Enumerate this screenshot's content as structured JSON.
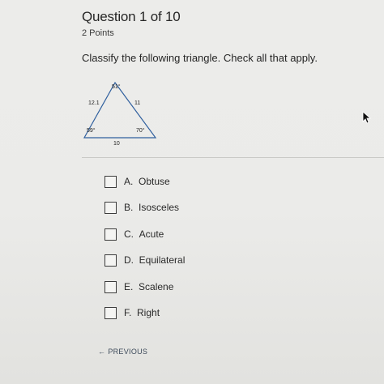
{
  "question": {
    "title": "Question 1 of 10",
    "points": "2 Points",
    "prompt": "Classify the following triangle. Check all that apply."
  },
  "triangle": {
    "angle_top": "51°",
    "angle_left": "59°",
    "angle_right": "70°",
    "side_left": "12.1",
    "side_right": "11",
    "side_bottom": "10"
  },
  "options": [
    {
      "letter": "A.",
      "text": "Obtuse"
    },
    {
      "letter": "B.",
      "text": "Isosceles"
    },
    {
      "letter": "C.",
      "text": "Acute"
    },
    {
      "letter": "D.",
      "text": "Equilateral"
    },
    {
      "letter": "E.",
      "text": "Scalene"
    },
    {
      "letter": "F.",
      "text": "Right"
    }
  ],
  "nav": {
    "previous_label": "PREVIOUS",
    "previous_icon": "arrow-left-icon"
  },
  "colors": {
    "background": "#ebebe9",
    "triangle_stroke": "#2f5f9e",
    "text": "#2a2a2a"
  }
}
